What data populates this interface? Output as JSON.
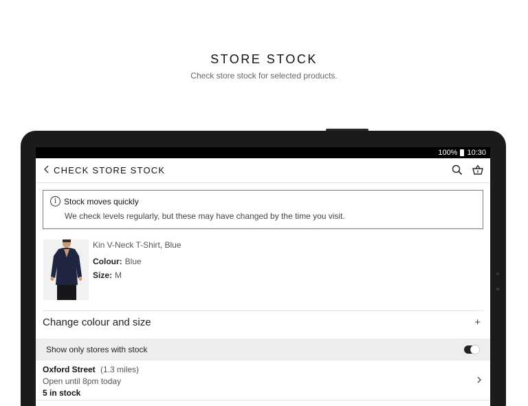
{
  "hero": {
    "title": "STORE STOCK",
    "subtitle": "Check store stock for selected products."
  },
  "status_bar": {
    "battery": "100%",
    "time": "10:30"
  },
  "app_bar": {
    "back_icon": "chevron-left-icon",
    "title": "CHECK STORE STOCK",
    "icons": [
      "search-icon",
      "basket-icon"
    ]
  },
  "notice": {
    "icon": "info-icon",
    "icon_glyph": "i",
    "title": "Stock moves quickly",
    "body": "We check levels regularly, but these may have changed by the time you visit."
  },
  "product": {
    "name": "Kin V-Neck T-Shirt, Blue",
    "colour_label": "Colour:",
    "colour_value": "Blue",
    "size_label": "Size:",
    "size_value": "M"
  },
  "change": {
    "label": "Change colour and size",
    "icon": "plus-icon",
    "glyph": "+"
  },
  "filter": {
    "label": "Show only stores with stock",
    "toggle_on": true
  },
  "stores": [
    {
      "name": "Oxford Street",
      "distance": "(1.3 miles)",
      "hours": "Open until 8pm today",
      "stock": "5 in stock"
    }
  ],
  "colors": {
    "accent": "#1b1b1b",
    "filter_bg": "#eeeeee",
    "border": "#7a7a7a"
  }
}
